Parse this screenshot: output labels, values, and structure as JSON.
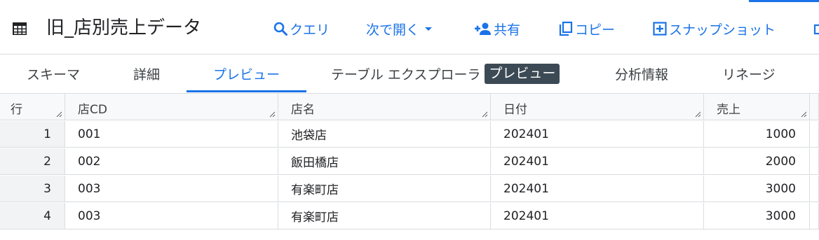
{
  "header": {
    "title": "旧_店別売上データ",
    "toolbar": {
      "query": "クエリ",
      "open_with": "次で開く",
      "share": "共有",
      "copy": "コピー",
      "snapshot": "スナップショット"
    }
  },
  "tabs": {
    "schema": "スキーマ",
    "details": "詳細",
    "preview": "プレビュー",
    "table_explorer": "テーブル エクスプローラ",
    "table_explorer_badge": "プレビュー",
    "analysis": "分析情報",
    "lineage": "リネージ",
    "active": "preview"
  },
  "table": {
    "columns": [
      "行",
      "店CD",
      "店名",
      "日付",
      "売上"
    ],
    "rows": [
      {
        "row": "1",
        "store_cd": "001",
        "store_name": "池袋店",
        "date": "202401",
        "sales": "1000"
      },
      {
        "row": "2",
        "store_cd": "002",
        "store_name": "飯田橋店",
        "date": "202401",
        "sales": "2000"
      },
      {
        "row": "3",
        "store_cd": "003",
        "store_name": "有楽町店",
        "date": "202401",
        "sales": "3000"
      },
      {
        "row": "4",
        "store_cd": "003",
        "store_name": "有楽町店",
        "date": "202401",
        "sales": "3000"
      }
    ]
  },
  "colors": {
    "accent": "#1a73e8",
    "badge_bg": "#3c4a55",
    "border": "#dadce0"
  },
  "icons": [
    "table-icon",
    "search-icon",
    "caret-down-icon",
    "person-add-icon",
    "copy-icon",
    "snapshot-icon",
    "more-icon"
  ]
}
